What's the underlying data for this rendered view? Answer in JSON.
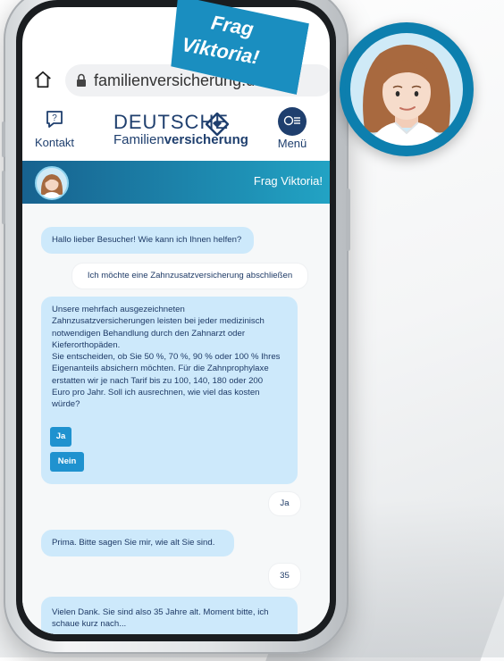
{
  "browser": {
    "url_text": "familienversicherung.de"
  },
  "site": {
    "contact_label": "Kontakt",
    "logo_top": "DEUTSCHE",
    "logo_bottom_light": "Familien",
    "logo_bottom_bold": "versicherung",
    "menu_label": "Menü"
  },
  "chat": {
    "header_title": "Frag Viktoria!",
    "messages": [
      {
        "from": "bot",
        "text": "Hallo lieber Besucher! Wie kann ich Ihnen helfen?"
      },
      {
        "from": "user",
        "text": "Ich möchte eine Zahnzusatzversicherung abschließen"
      },
      {
        "from": "bot",
        "lines": [
          "Unsere mehrfach ausgezeichneten",
          "Zahnzusatzversicherungen leisten bei jeder medizinisch",
          "notwendigen Behandlung durch den Zahnarzt oder",
          "Kieferorthopäden.",
          "Sie entscheiden, ob Sie 50 %, 70 %, 90 % oder 100 % Ihres",
          "Eigenanteils absichern möchten. Für die Zahnprophylaxe",
          "erstatten wir je nach Tarif bis zu 100, 140, 180 oder 200",
          "Euro pro Jahr. Soll ich ausrechnen, wie viel das kosten",
          "würde?"
        ]
      },
      {
        "from": "user",
        "text": "Ja"
      },
      {
        "from": "bot",
        "text": "Prima. Bitte sagen Sie mir, wie alt Sie sind."
      },
      {
        "from": "user",
        "text": "35"
      },
      {
        "from": "bot",
        "lines": [
          "Vielen Dank. Sie sind also 35 Jahre alt. Moment bitte, ich",
          "schaue kurz nach..."
        ]
      }
    ],
    "quick_replies": [
      "Ja",
      "Nein"
    ]
  },
  "badge": {
    "line1": "Frag",
    "line2": "Viktoria!"
  },
  "colors": {
    "brand_navy": "#1f3f6e",
    "accent_blue": "#1a8ec0",
    "bot_bubble": "#cde9fb",
    "button_blue": "#1f92cf"
  },
  "icons": [
    "home-icon",
    "lock-icon",
    "chat-question-icon",
    "menu-chat-icon",
    "avatar-icon"
  ]
}
